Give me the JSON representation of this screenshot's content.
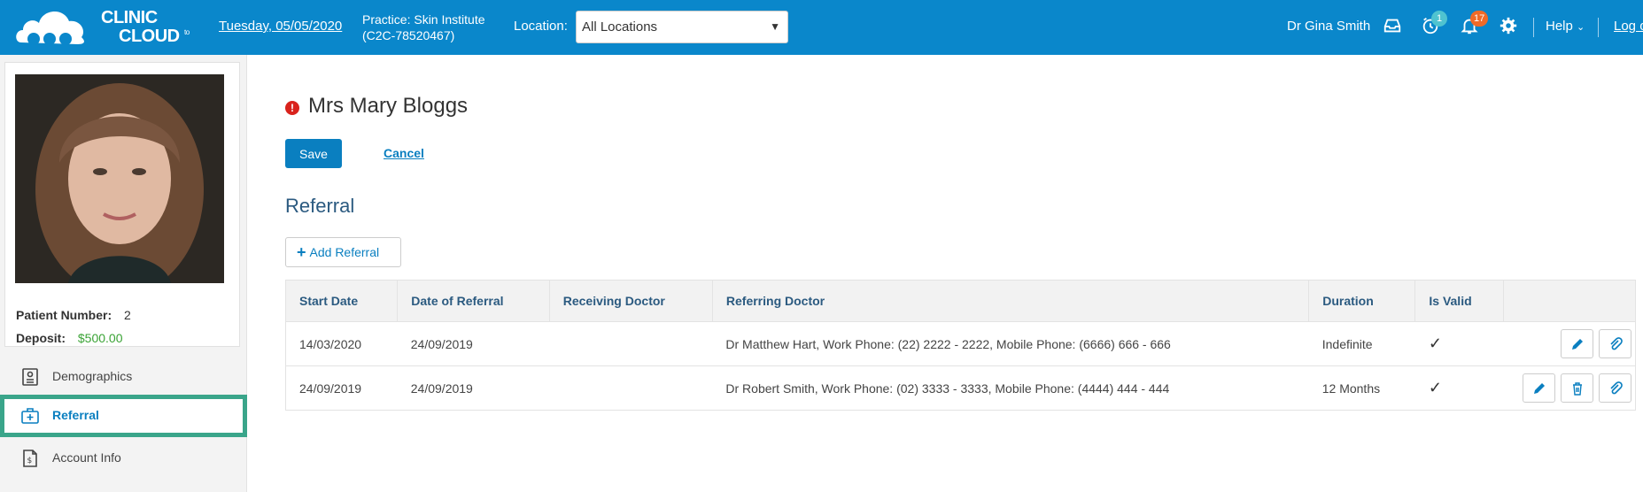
{
  "header": {
    "logo": {
      "line1": "CLINIC",
      "to": "to",
      "line2": "CLOUD"
    },
    "date": "Tuesday, 05/05/2020",
    "practice_line1": "Practice: Skin Institute",
    "practice_line2": "(C2C-78520467)",
    "location_label": "Location:",
    "location_value": "All Locations",
    "user": "Dr Gina Smith",
    "reminders_badge": "1",
    "notifications_badge": "17",
    "help": "Help",
    "logout": "Log out"
  },
  "icons": {
    "inbox": "inbox-icon",
    "reminder": "alarm-clock-icon",
    "notifications": "bell-icon",
    "settings": "gear-icon"
  },
  "sidebar": {
    "patient_number_label": "Patient Number:",
    "patient_number": "2",
    "deposit_label": "Deposit:",
    "deposit": "$500.00",
    "items": [
      {
        "label": "Demographics",
        "icon": "id-card-icon",
        "active": false
      },
      {
        "label": "Referral",
        "icon": "medical-case-icon",
        "active": true
      },
      {
        "label": "Account Info",
        "icon": "invoice-dollar-icon",
        "active": false
      }
    ]
  },
  "main": {
    "alert_glyph": "!",
    "patient_name": "Mrs Mary Bloggs",
    "save_label": "Save",
    "cancel_label": "Cancel",
    "section_title": "Referral",
    "add_label": "Add Referral",
    "columns": [
      "Start Date",
      "Date of Referral",
      "Receiving Doctor",
      "Referring Doctor",
      "Duration",
      "Is Valid",
      ""
    ],
    "rows": [
      {
        "start_date": "14/03/2020",
        "date_of_referral": "24/09/2019",
        "receiving_doctor": "",
        "referring_doctor": "Dr Matthew Hart, Work Phone: (22) 2222 - 2222, Mobile Phone: (6666) 666 - 666",
        "duration": "Indefinite",
        "is_valid": "✓"
      },
      {
        "start_date": "24/09/2019",
        "date_of_referral": "24/09/2019",
        "receiving_doctor": "",
        "referring_doctor": "Dr Robert Smith, Work Phone: (02) 3333 - 3333, Mobile Phone: (4444) 444 - 444",
        "duration": "12 Months",
        "is_valid": "✓"
      }
    ]
  },
  "colors": {
    "header_blue": "#0a87cb",
    "accent_blue": "#0a7fc0",
    "active_border": "#3aa58a",
    "deposit_green": "#3aa335",
    "badge_teal": "#4fc3d0",
    "badge_orange": "#f06a28",
    "alert_red": "#d9221c"
  }
}
